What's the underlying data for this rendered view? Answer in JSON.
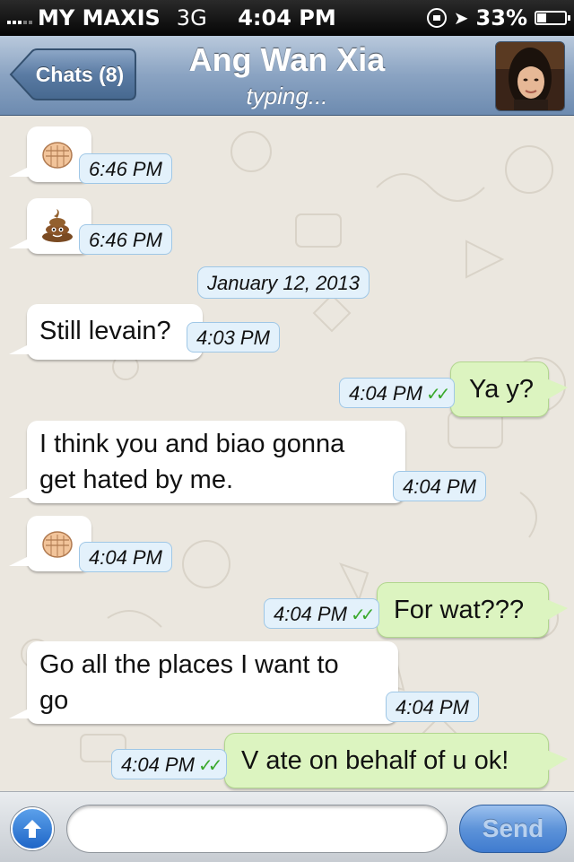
{
  "status_bar": {
    "carrier": "MY MAXIS",
    "network": "3G",
    "time": "4:04 PM",
    "battery": "33%",
    "battery_level": 0.33
  },
  "nav": {
    "back_label": "Chats (8)",
    "contact_name": "Ang Wan Xia",
    "contact_status": "typing..."
  },
  "messages": [
    {
      "dir": "in",
      "emoji": "fist-emoji",
      "time": "6:46 PM"
    },
    {
      "dir": "in",
      "emoji": "poop-emoji",
      "time": "6:46 PM"
    },
    {
      "type": "date",
      "text": "January 12, 2013"
    },
    {
      "dir": "in",
      "text": "Still levain?",
      "time": "4:03 PM"
    },
    {
      "dir": "out",
      "text": "Ya y?",
      "time": "4:04 PM"
    },
    {
      "dir": "in",
      "lines": [
        "I think you and biao gonna",
        "get hated by me."
      ],
      "time": "4:04 PM"
    },
    {
      "dir": "in",
      "emoji": "fist-emoji",
      "time": "4:04 PM"
    },
    {
      "dir": "out",
      "text": "For wat???",
      "time": "4:04 PM"
    },
    {
      "dir": "in",
      "lines": [
        "Go all the places I want to",
        "go"
      ],
      "time": "4:04 PM"
    },
    {
      "dir": "out",
      "text": "V ate on behalf of u ok!",
      "time": "4:04 PM"
    }
  ],
  "input": {
    "placeholder": "",
    "send_label": "Send"
  },
  "colors": {
    "outgoing_bubble": "#dcf4c0",
    "incoming_bubble": "#ffffff",
    "timestamp_bg": "#e3f1fb",
    "read_ticks": "#3aa82c",
    "nav_bar": "#7f9abb"
  }
}
